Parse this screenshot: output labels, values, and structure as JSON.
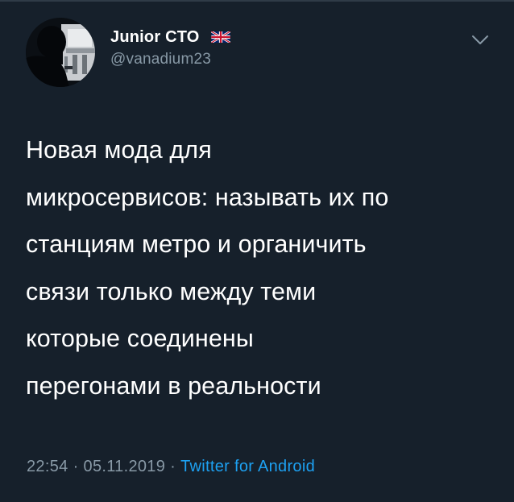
{
  "tweet": {
    "author": {
      "display_name": "Junior CTO",
      "flag_icon": "uk-flag-icon",
      "handle": "@vanadium23"
    },
    "text_lines": [
      "Новая мода для",
      "микросервисов: называть их по",
      "станциям метро и органичить",
      "связи только между теми",
      "которые соединены",
      "перегонами в реальности"
    ],
    "time": "22:54",
    "separator": "·",
    "date": "05.11.2019",
    "source": "Twitter for Android"
  },
  "colors": {
    "background": "#16202b",
    "text": "#ffffff",
    "secondary_text": "#8899a6",
    "link": "#1da1f2"
  }
}
